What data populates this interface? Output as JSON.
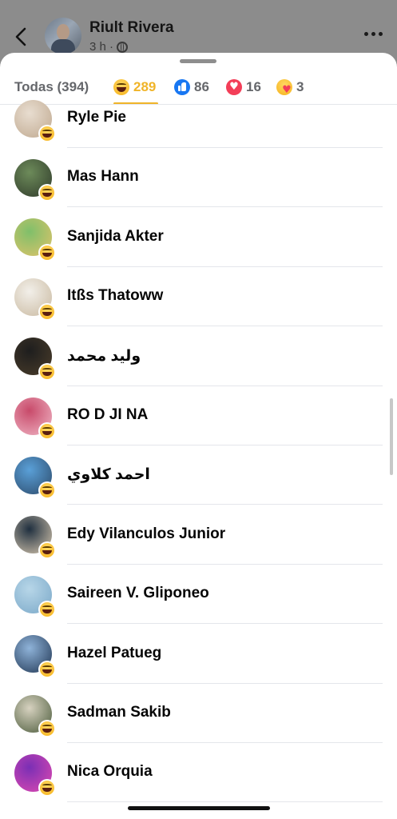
{
  "post": {
    "author": "Riult Rivera",
    "meta": "3 h ·",
    "back_icon": "chevron-left-icon",
    "more_icon": "more-horizontal-icon"
  },
  "tabs": [
    {
      "label": "Todas (394)",
      "icon": "",
      "active": false
    },
    {
      "label": "289",
      "icon": "haha-icon",
      "active": true
    },
    {
      "label": "86",
      "icon": "like-icon",
      "active": false
    },
    {
      "label": "16",
      "icon": "love-icon",
      "active": false
    },
    {
      "label": "3",
      "icon": "care-icon",
      "active": false
    }
  ],
  "colors": {
    "active_tab": "#f0b429",
    "like": "#1877f2",
    "love": "#f33e58"
  },
  "reactors": [
    {
      "name": "Ryle Pie",
      "avatar": [
        "#e8ddd0",
        "#bfa88e"
      ],
      "reaction": "haha"
    },
    {
      "name": "Mas Hann",
      "avatar": [
        "#6d8b5a",
        "#2f3a2a"
      ],
      "reaction": "haha"
    },
    {
      "name": "Sanjida Akter",
      "avatar": [
        "#7fbf6a",
        "#e0c36a"
      ],
      "reaction": "haha"
    },
    {
      "name": "Itßs Thatoww",
      "avatar": [
        "#f2efe9",
        "#c9b9a0"
      ],
      "reaction": "haha"
    },
    {
      "name": "وليد محمد",
      "avatar": [
        "#1e1e1e",
        "#4b3d2a"
      ],
      "reaction": "haha"
    },
    {
      "name": "RO D JI NA",
      "avatar": [
        "#c84a6a",
        "#f0b7c6"
      ],
      "reaction": "haha"
    },
    {
      "name": "احمد كلاوي",
      "avatar": [
        "#5aa0d8",
        "#2c4a6a"
      ],
      "reaction": "haha"
    },
    {
      "name": "Edy Vilanculos Junior",
      "avatar": [
        "#1f2f3f",
        "#d9c9b0"
      ],
      "reaction": "haha"
    },
    {
      "name": "Saireen V. Gliponeo",
      "avatar": [
        "#b7d6e8",
        "#7aa8c8"
      ],
      "reaction": "haha"
    },
    {
      "name": "Hazel Patueg",
      "avatar": [
        "#8fb3d9",
        "#1f3552"
      ],
      "reaction": "haha"
    },
    {
      "name": "Sadman Sakib",
      "avatar": [
        "#d7d2c0",
        "#4a5a3a"
      ],
      "reaction": "haha"
    },
    {
      "name": "Nica Orquia",
      "avatar": [
        "#7a2fb5",
        "#e04ab0"
      ],
      "reaction": "haha"
    }
  ]
}
